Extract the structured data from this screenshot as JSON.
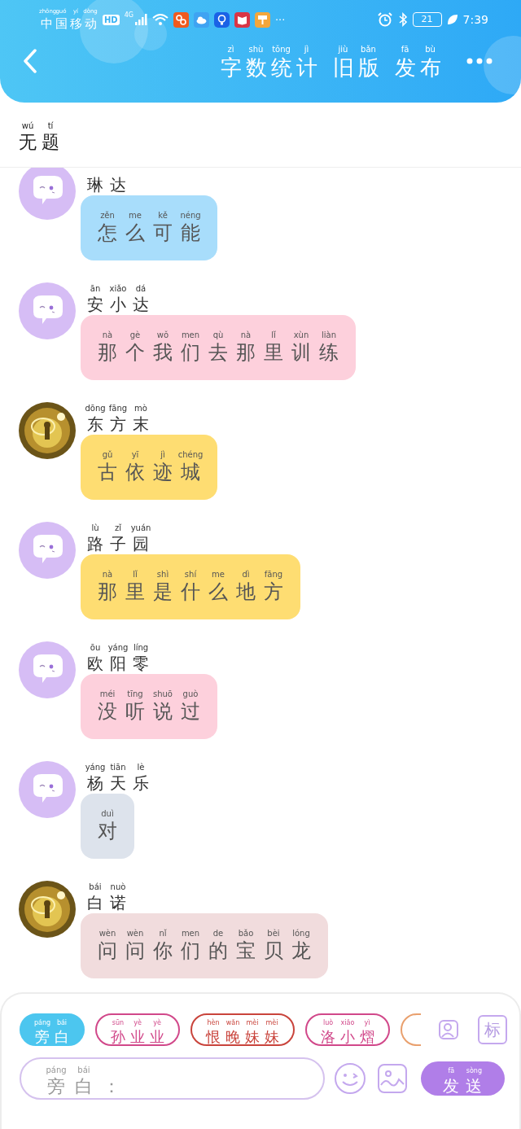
{
  "status_bar": {
    "carrier": {
      "chars": "中国移动",
      "pinyin": [
        "zhōng",
        "guó",
        "yí",
        "dòng"
      ]
    },
    "hd": "HD",
    "network": "4G",
    "more": "···",
    "battery": "21",
    "time": "7:39"
  },
  "header": {
    "actions": [
      {
        "chars": "字数统计",
        "pinyin": [
          "zì",
          "shù",
          "tǒng",
          "jì"
        ]
      },
      {
        "chars": "旧版",
        "pinyin": [
          "jiù",
          "bǎn"
        ]
      },
      {
        "chars": "发布",
        "pinyin": [
          "fā",
          "bù"
        ]
      }
    ]
  },
  "title": {
    "chars": "无题",
    "pinyin": [
      "wú",
      "tí"
    ]
  },
  "messages": [
    {
      "kind": "bot",
      "name": {
        "chars": "琳达"
      },
      "text": {
        "chars": "怎么可能",
        "pinyin": [
          "zěn",
          "me",
          "kě",
          "néng"
        ]
      },
      "color": "#a8ddfb"
    },
    {
      "kind": "bot",
      "name": {
        "chars": "安小达",
        "pinyin": [
          "ān",
          "xiǎo",
          "dá"
        ]
      },
      "text": {
        "chars": "那个我们去那里训练",
        "pinyin": [
          "nà",
          "gè",
          "wǒ",
          "men",
          "qù",
          "nà",
          "lǐ",
          "xùn",
          "liàn"
        ]
      },
      "color": "#fdd0dc"
    },
    {
      "kind": "picture",
      "name": {
        "chars": "东方末",
        "pinyin": [
          "dōng",
          "fāng",
          "mò"
        ]
      },
      "text": {
        "chars": "古依迹城",
        "pinyin": [
          "gǔ",
          "yī",
          "jì",
          "chéng"
        ]
      },
      "color": "#fedd72"
    },
    {
      "kind": "bot",
      "name": {
        "chars": "路子园",
        "pinyin": [
          "lù",
          "zǐ",
          "yuán"
        ]
      },
      "text": {
        "chars": "那里是什么地方",
        "pinyin": [
          "nà",
          "lǐ",
          "shì",
          "shí",
          "me",
          "dì",
          "fāng"
        ]
      },
      "color": "#fedd72"
    },
    {
      "kind": "bot",
      "name": {
        "chars": "欧阳零",
        "pinyin": [
          "ōu",
          "yáng",
          "líng"
        ]
      },
      "text": {
        "chars": "没听说过",
        "pinyin": [
          "méi",
          "tīng",
          "shuō",
          "guò"
        ]
      },
      "color": "#fdd0dc"
    },
    {
      "kind": "bot",
      "name": {
        "chars": "杨天乐",
        "pinyin": [
          "yáng",
          "tiān",
          "lè"
        ]
      },
      "text": {
        "chars": "对",
        "pinyin": [
          "duì"
        ]
      },
      "color": "#dde3ec"
    },
    {
      "kind": "picture",
      "name": {
        "chars": "白诺",
        "pinyin": [
          "bái",
          "nuò"
        ]
      },
      "text": {
        "chars": "问问你们的宝贝龙",
        "pinyin": [
          "wèn",
          "wèn",
          "nǐ",
          "men",
          "de",
          "bǎo",
          "bèi",
          "lóng"
        ]
      },
      "color": "#f1dcdd"
    }
  ],
  "roles": [
    {
      "label": {
        "chars": "旁白",
        "pinyin": [
          "páng",
          "bái"
        ]
      },
      "selected": true,
      "color": "#4cc6ef"
    },
    {
      "label": {
        "chars": "孙业业",
        "pinyin": [
          "sūn",
          "yè",
          "yè"
        ]
      },
      "selected": false,
      "color": "#d1488a"
    },
    {
      "label": {
        "chars": "恨晚妹妹",
        "pinyin": [
          "hèn",
          "wǎn",
          "mèi",
          "mèi"
        ]
      },
      "selected": false,
      "color": "#c9443c"
    },
    {
      "label": {
        "chars": "洛小熠",
        "pinyin": [
          "luò",
          "xiǎo",
          "yì"
        ]
      },
      "selected": false,
      "color": "#d1488a"
    },
    {
      "selected": false,
      "color": "#e9a06e"
    }
  ],
  "tag_button": "标",
  "input": {
    "placeholder": {
      "chars": "旁白：",
      "pinyin": [
        "páng",
        "bái"
      ]
    }
  },
  "send_button": {
    "chars": "发送",
    "pinyin": [
      "fā",
      "sòng"
    ]
  }
}
